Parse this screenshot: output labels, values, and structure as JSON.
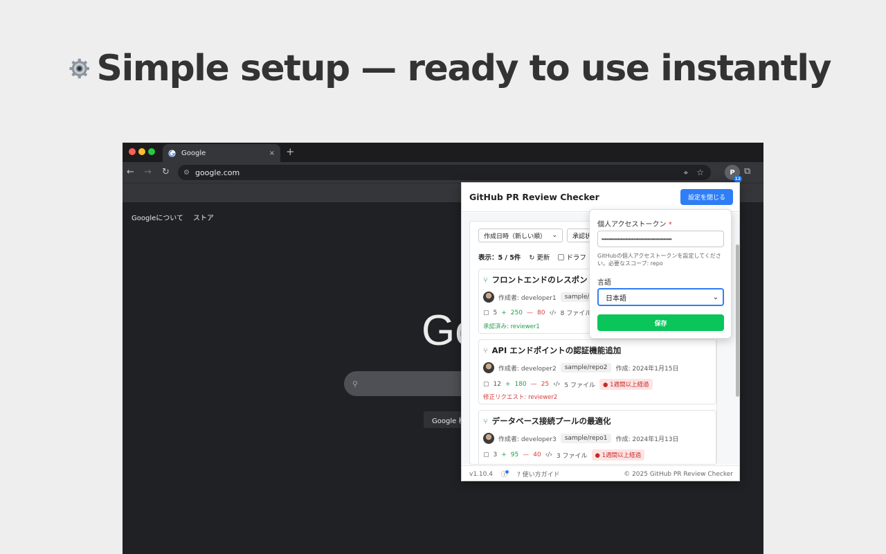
{
  "headline": {
    "text": "Simple setup — ready to use instantly",
    "icon": "gear-icon"
  },
  "browser": {
    "tab": {
      "title": "Google",
      "close": "×"
    },
    "new_tab": "+",
    "url": "google.com",
    "extension_badge": "12",
    "google_links": [
      "Googleについて",
      "ストア"
    ],
    "google_logo": "Go",
    "google_button": "Google 検"
  },
  "popup": {
    "title": "GitHub PR Review Checker",
    "close_settings_button": "設定を閉じる",
    "filters": {
      "sort_value": "作成日時（新しい順）",
      "status_value": "承認状"
    },
    "info": {
      "count": "表示：5 / 5件",
      "refresh": "更新",
      "draft": "ドラフ"
    },
    "prs": [
      {
        "title": "フロントエンドのレスポン",
        "author": "作成者: developer1",
        "repo": "sample/repo",
        "created": "",
        "comments": "5",
        "additions": "250",
        "deletions": "80",
        "files": "8 ファイル",
        "badge": "",
        "status": "承認済み: reviewer1",
        "status_color": "#1f9d4a"
      },
      {
        "title": "API エンドポイントの認証機能追加",
        "author": "作成者: developer2",
        "repo": "sample/repo2",
        "created": "作成: 2024年1月15日",
        "comments": "12",
        "additions": "180",
        "deletions": "25",
        "files": "5 ファイル",
        "badge": "1週間以上経過",
        "status": "修正リクエスト: reviewer2",
        "status_color": "#d73a3a"
      },
      {
        "title": "データベース接続プールの最適化",
        "author": "作成者: developer3",
        "repo": "sample/repo1",
        "created": "作成: 2024年1月13日",
        "comments": "3",
        "additions": "95",
        "deletions": "40",
        "files": "3 ファイル",
        "badge": "1週間以上経過",
        "status": "",
        "status_color": "#555555"
      }
    ],
    "footer": {
      "version": "v1.10.4",
      "guide": "使い方ガイド",
      "copyright": "© 2025 GitHub PR Review Checker"
    }
  },
  "settings": {
    "token_label": "個人アクセストークン",
    "required_mark": "*",
    "token_value": "••••••••••••••••••••••••••••••••••••••••••••",
    "help": "GitHubの個人アクセストークンを設定してください。必要なスコープ: repo",
    "language_label": "言語",
    "language_value": "日本語",
    "save_button": "保存"
  },
  "colors": {
    "primary": "#2f7ef6",
    "save": "#09c55a",
    "addition": "#1f9d4a",
    "deletion": "#d73a3a"
  }
}
